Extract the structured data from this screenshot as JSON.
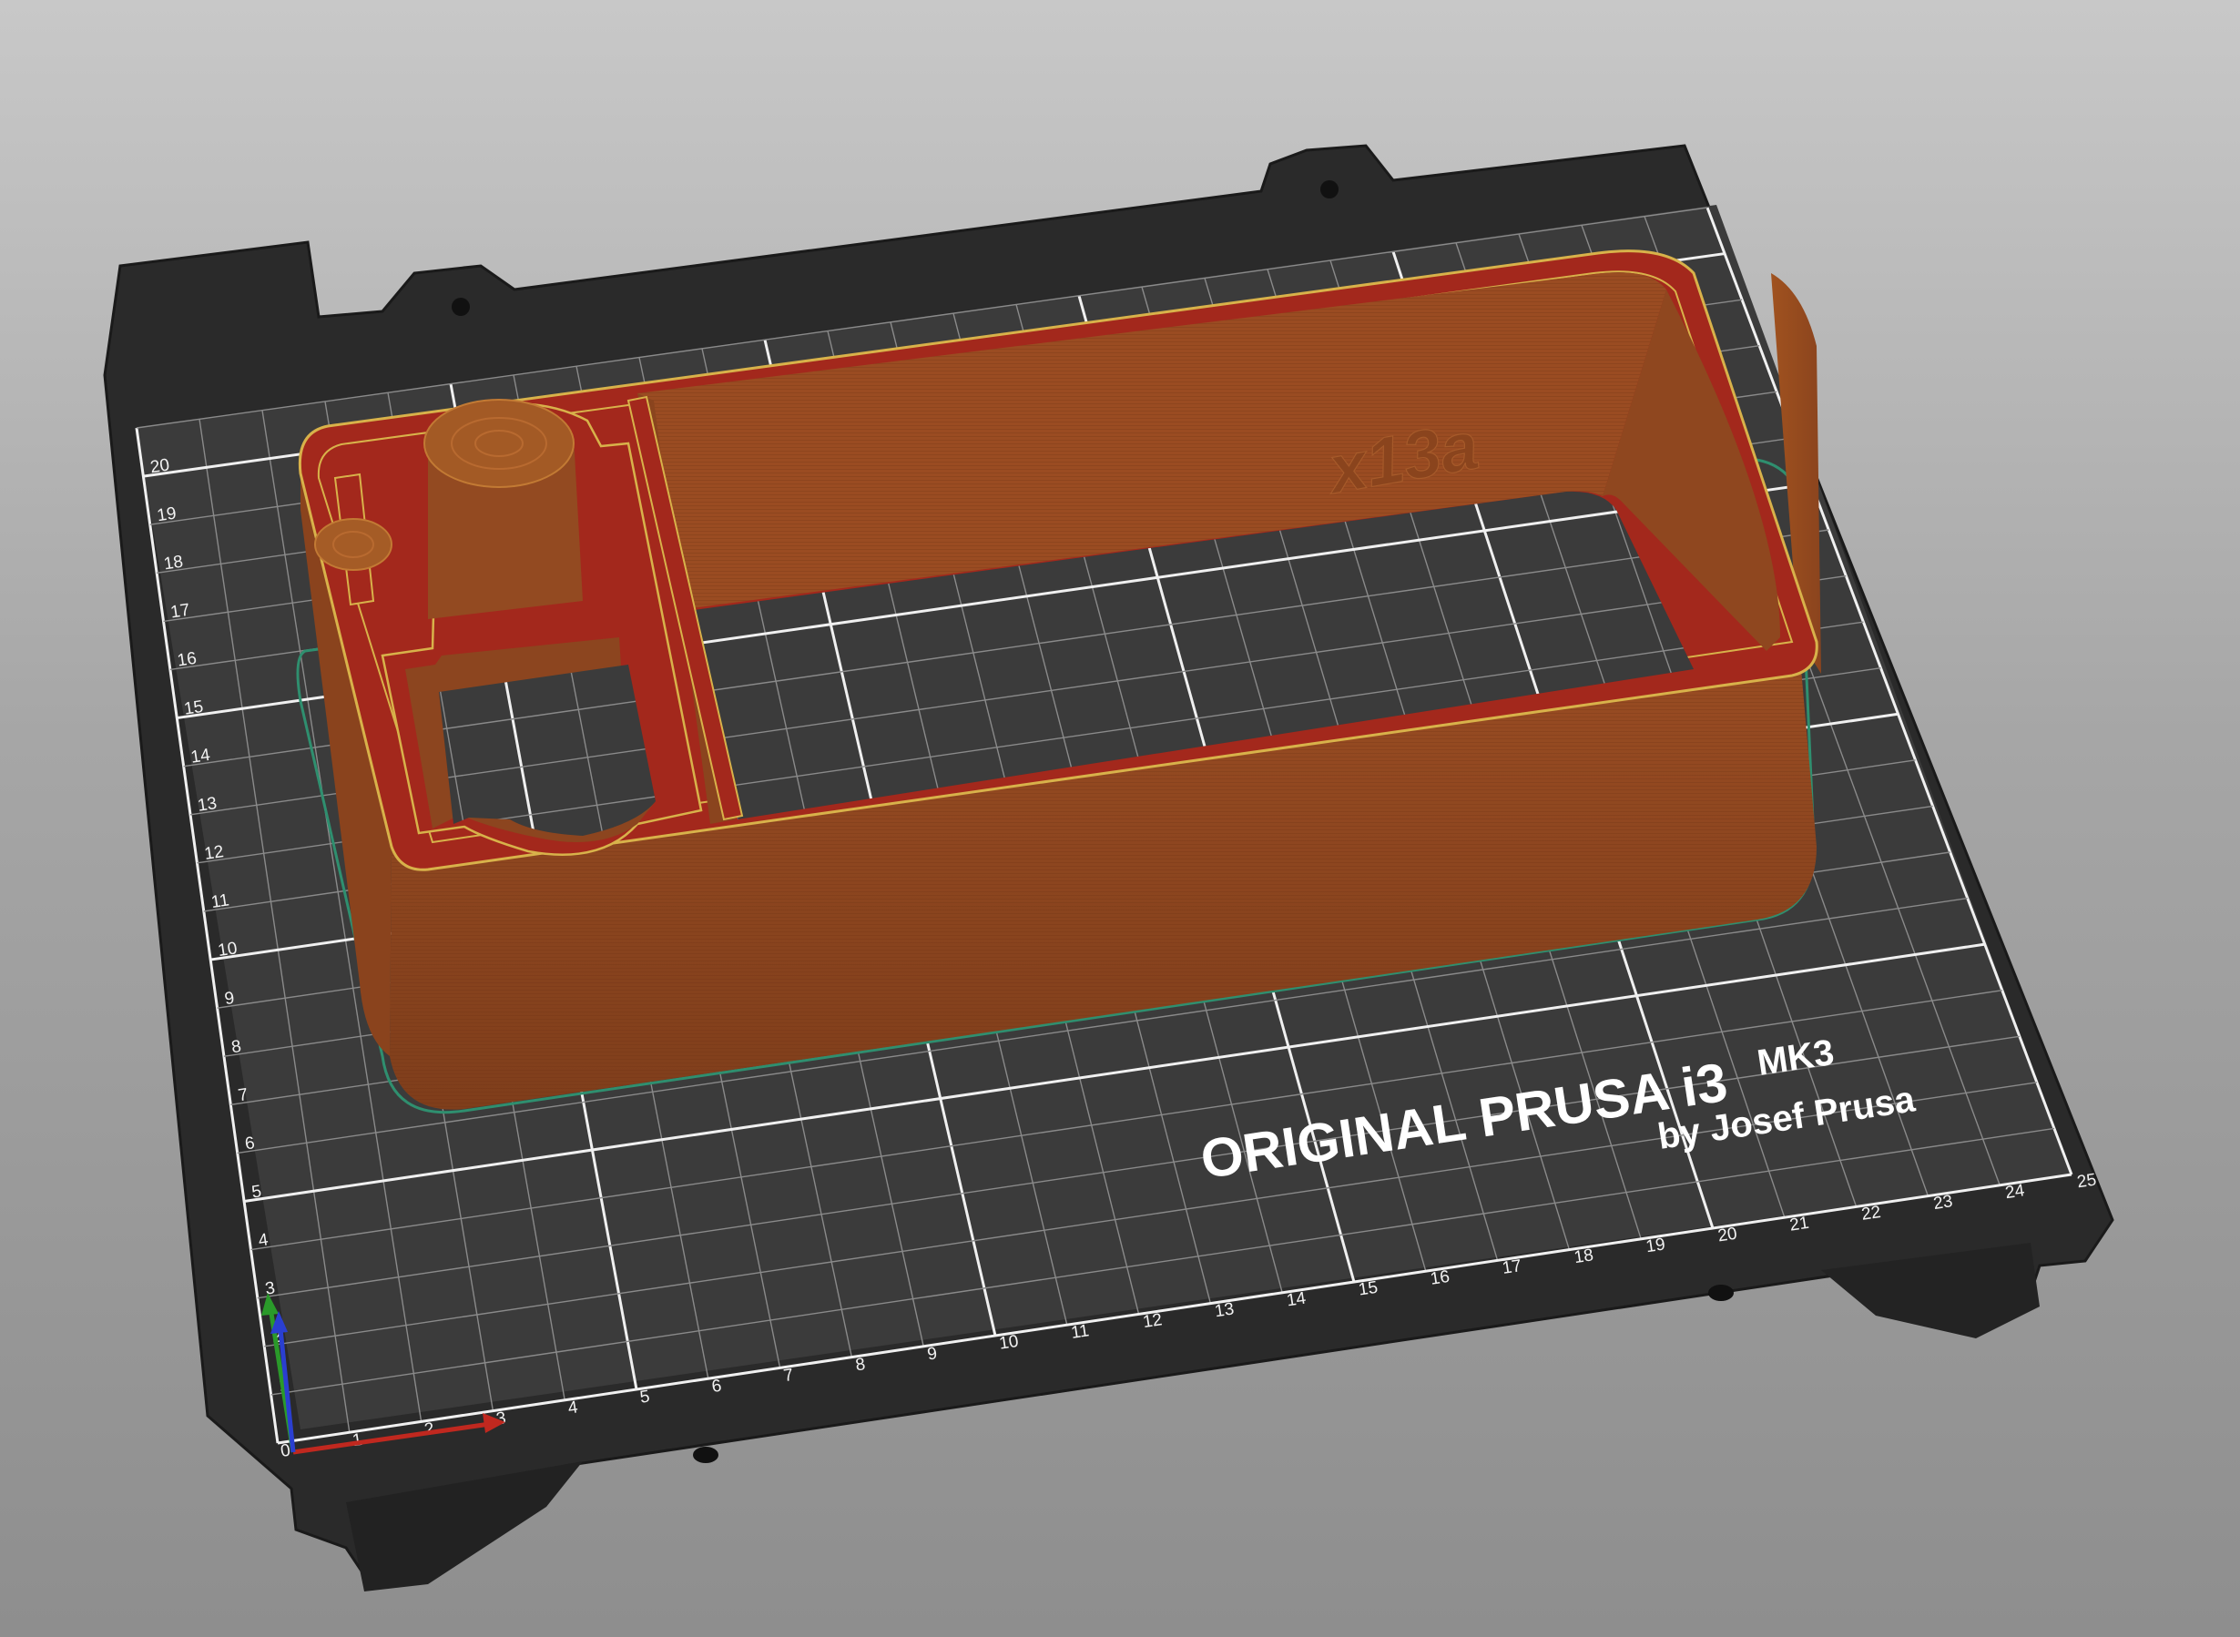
{
  "bed": {
    "brand_line_1_a": "ORIGINAL PRUSA i3",
    "brand_line_1_b": "MK3",
    "brand_line_2": "by Josef Prusa",
    "x_ticks": [
      "0",
      "1",
      "2",
      "3",
      "4",
      "5",
      "6",
      "7",
      "8",
      "9",
      "10",
      "11",
      "12",
      "13",
      "14",
      "15",
      "16",
      "17",
      "18",
      "19",
      "20",
      "21",
      "22",
      "23",
      "24",
      "25"
    ],
    "y_ticks": [
      "1",
      "2",
      "3",
      "4",
      "5",
      "6",
      "7",
      "8",
      "9",
      "10",
      "11",
      "12",
      "13",
      "14",
      "15",
      "16",
      "17",
      "18",
      "19",
      "20"
    ]
  },
  "model": {
    "embossed_label": "x13a",
    "colors": {
      "wall": "#8e4620",
      "wall_top": "#b8622a",
      "infill": "#a1261c",
      "perimeter": "#d8b24a",
      "skirt": "#2f8f6f"
    }
  },
  "axes": {
    "x_color": "#c0281f",
    "y_color": "#2a9a2a",
    "z_color": "#2a3fd0"
  },
  "colors": {
    "bed_plate": "#2b2b2b",
    "bed_sheet": "#3a3a3a",
    "grid_minor": "#8a8a8a",
    "grid_major": "#f0f0f0"
  }
}
